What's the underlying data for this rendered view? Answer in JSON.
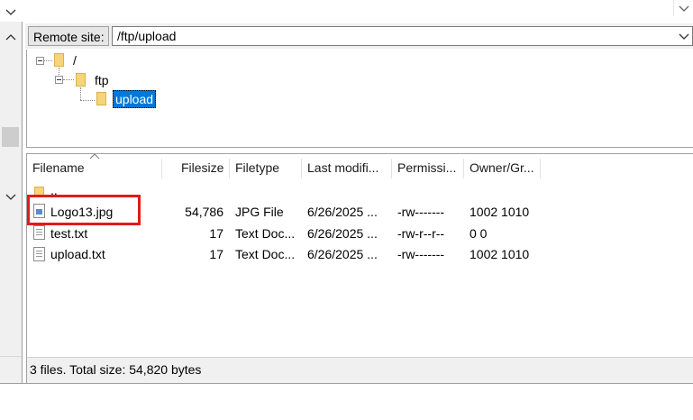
{
  "remote_site": {
    "label": "Remote site:",
    "path": "/ftp/upload"
  },
  "tree": [
    {
      "label": "/"
    },
    {
      "label": "ftp"
    },
    {
      "label": "upload",
      "selected": true
    }
  ],
  "columns": [
    "Filename",
    "Filesize",
    "Filetype",
    "Last modifi...",
    "Permissi...",
    "Owner/Gr..."
  ],
  "files": [
    {
      "name": "..",
      "size": "",
      "type": "",
      "modified": "",
      "perms": "",
      "owner": "",
      "icon": "folder-icon"
    },
    {
      "name": "Logo13.jpg",
      "size": "54,786",
      "type": "JPG File",
      "modified": "6/26/2025 ...",
      "perms": "-rw-------",
      "owner": "1002 1010",
      "icon": "image-file-icon",
      "highlighted": true
    },
    {
      "name": "test.txt",
      "size": "17",
      "type": "Text Doc...",
      "modified": "6/26/2025 ...",
      "perms": "-rw-r--r--",
      "owner": "0 0",
      "icon": "text-file-icon"
    },
    {
      "name": "upload.txt",
      "size": "17",
      "type": "Text Doc...",
      "modified": "6/26/2025 ...",
      "perms": "-rw-------",
      "owner": "1002 1010",
      "icon": "text-file-icon"
    }
  ],
  "status": "3 files. Total size: 54,820 bytes",
  "colors": {
    "selection": "#0078d7",
    "highlight_border": "#e01b1b"
  }
}
